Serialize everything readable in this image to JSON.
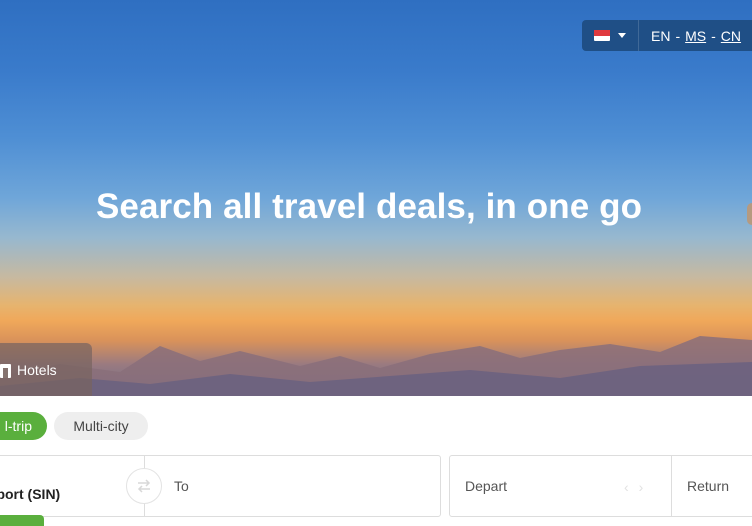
{
  "header": {
    "country_flag_icon": "singapore-flag-icon",
    "languages": {
      "en": "EN",
      "ms": "MS",
      "cn": "CN",
      "separator": "-"
    }
  },
  "hero": {
    "title": "Search all travel deals, in one go"
  },
  "tabs": {
    "hotels": "Hotels"
  },
  "trip_types": {
    "round_trip": "l-trip",
    "multi_city": "Multi-city"
  },
  "search": {
    "from_value": "rport (SIN)",
    "to_placeholder": "To",
    "depart_placeholder": "Depart",
    "return_placeholder": "Return"
  },
  "colors": {
    "accent_green": "#5aaf3d",
    "locale_bar": "#1f4f86"
  }
}
